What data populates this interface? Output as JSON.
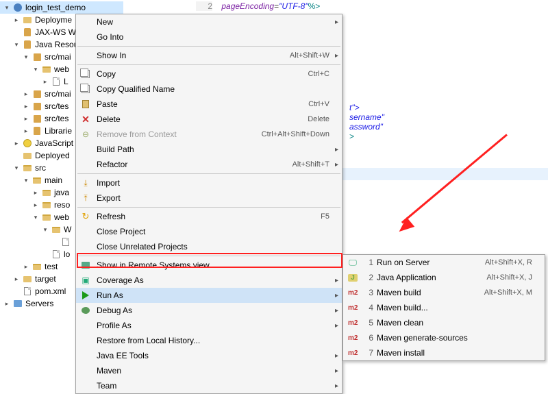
{
  "tree": {
    "items": [
      {
        "d": 0,
        "tw": "▾",
        "icon": "web",
        "label": "login_test_demo",
        "sel": true
      },
      {
        "d": 1,
        "tw": "▸",
        "icon": "folder",
        "label": "Deployme"
      },
      {
        "d": 1,
        "tw": " ",
        "icon": "jar",
        "label": "JAX-WS W"
      },
      {
        "d": 1,
        "tw": "▾",
        "icon": "jar",
        "label": "Java Resou"
      },
      {
        "d": 2,
        "tw": "▾",
        "icon": "pkg",
        "label": "src/mai"
      },
      {
        "d": 3,
        "tw": "▾",
        "icon": "folder-open",
        "label": "web"
      },
      {
        "d": 4,
        "tw": "▸",
        "icon": "file",
        "label": "L"
      },
      {
        "d": 2,
        "tw": "▸",
        "icon": "pkg",
        "label": "src/mai"
      },
      {
        "d": 2,
        "tw": "▸",
        "icon": "pkg",
        "label": "src/tes"
      },
      {
        "d": 2,
        "tw": "▸",
        "icon": "pkg",
        "label": "src/tes"
      },
      {
        "d": 2,
        "tw": "▸",
        "icon": "jar",
        "label": "Librarie"
      },
      {
        "d": 1,
        "tw": "▸",
        "icon": "js",
        "label": "JavaScript"
      },
      {
        "d": 1,
        "tw": " ",
        "icon": "folder",
        "label": "Deployed"
      },
      {
        "d": 1,
        "tw": "▾",
        "icon": "folder-open",
        "label": "src"
      },
      {
        "d": 2,
        "tw": "▾",
        "icon": "folder-open",
        "label": "main"
      },
      {
        "d": 3,
        "tw": "▸",
        "icon": "folder-open",
        "label": "java"
      },
      {
        "d": 3,
        "tw": "▸",
        "icon": "folder-open",
        "label": "reso"
      },
      {
        "d": 3,
        "tw": "▾",
        "icon": "folder-open",
        "label": "web"
      },
      {
        "d": 4,
        "tw": "▾",
        "icon": "folder-open",
        "label": "W"
      },
      {
        "d": 5,
        "tw": " ",
        "icon": "file",
        "label": ""
      },
      {
        "d": 4,
        "tw": " ",
        "icon": "file",
        "label": "lo"
      },
      {
        "d": 2,
        "tw": "▸",
        "icon": "folder-open",
        "label": "test"
      },
      {
        "d": 1,
        "tw": "▸",
        "icon": "folder",
        "label": "target"
      },
      {
        "d": 1,
        "tw": " ",
        "icon": "file",
        "label": "pom.xml"
      },
      {
        "d": 0,
        "tw": "▸",
        "icon": "srv",
        "label": "Servers"
      }
    ]
  },
  "editor": {
    "lineNum": "2",
    "attr": "pageEncoding",
    "eq": "=",
    "str": "\"UTF-8\"",
    "tail": "%>",
    "frags": [
      "t\">",
      "sername\"",
      "assword\"",
      ">"
    ]
  },
  "context_menu": {
    "groups": [
      [
        {
          "label": "New",
          "sub": true
        },
        {
          "label": "Go Into"
        }
      ],
      [
        {
          "label": "Show In",
          "acc": "Alt+Shift+W",
          "sub": true
        }
      ],
      [
        {
          "label": "Copy",
          "acc": "Ctrl+C",
          "icon": "copy"
        },
        {
          "label": "Copy Qualified Name",
          "icon": "copy"
        },
        {
          "label": "Paste",
          "acc": "Ctrl+V",
          "icon": "paste"
        },
        {
          "label": "Delete",
          "acc": "Delete",
          "icon": "del"
        },
        {
          "label": "Remove from Context",
          "acc": "Ctrl+Alt+Shift+Down",
          "dis": true,
          "icon": "minus"
        },
        {
          "label": "Build Path",
          "sub": true
        },
        {
          "label": "Refactor",
          "acc": "Alt+Shift+T",
          "sub": true
        }
      ],
      [
        {
          "label": "Import",
          "icon": "import"
        },
        {
          "label": "Export",
          "icon": "export"
        }
      ],
      [
        {
          "label": "Refresh",
          "acc": "F5",
          "icon": "refresh"
        },
        {
          "label": "Close Project"
        },
        {
          "label": "Close Unrelated Projects"
        }
      ],
      [
        {
          "label": "Show in Remote Systems view",
          "icon": "remote"
        },
        {
          "label": "Coverage As",
          "sub": true,
          "icon": "cov"
        },
        {
          "label": "Run As",
          "sub": true,
          "icon": "run",
          "hot": true
        },
        {
          "label": "Debug As",
          "sub": true,
          "icon": "bug"
        },
        {
          "label": "Profile As",
          "sub": true
        },
        {
          "label": "Restore from Local History..."
        },
        {
          "label": "Java EE Tools",
          "sub": true
        },
        {
          "label": "Maven",
          "sub": true
        },
        {
          "label": "Team",
          "sub": true
        }
      ]
    ]
  },
  "runas_menu": {
    "items": [
      {
        "n": "1",
        "label": "Run on Server",
        "acc": "Alt+Shift+X, R",
        "icon": "srv"
      },
      {
        "n": "2",
        "label": "Java Application",
        "acc": "Alt+Shift+X, J",
        "icon": "j"
      },
      {
        "n": "3",
        "label": "Maven build",
        "acc": "Alt+Shift+X, M",
        "icon": "mv"
      },
      {
        "n": "4",
        "label": "Maven build...",
        "icon": "mv"
      },
      {
        "n": "5",
        "label": "Maven clean",
        "icon": "mv"
      },
      {
        "n": "6",
        "label": "Maven generate-sources",
        "icon": "mv"
      },
      {
        "n": "7",
        "label": "Maven install",
        "icon": "mv"
      }
    ]
  }
}
